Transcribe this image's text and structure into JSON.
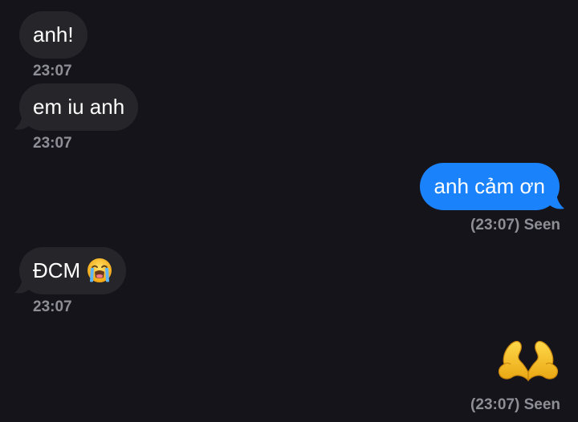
{
  "messages": [
    {
      "direction": "incoming",
      "text": "anh!",
      "time": "23:07"
    },
    {
      "direction": "incoming",
      "text": "em iu anh",
      "time": "23:07"
    },
    {
      "direction": "outgoing",
      "text": "anh cảm ơn",
      "status": "(23:07) Seen"
    },
    {
      "direction": "incoming",
      "text": "ĐCM",
      "emoji": "loudly-crying-face-icon",
      "time": "23:07"
    },
    {
      "direction": "outgoing",
      "emoji": "heart-hands-icon",
      "status": "(23:07) Seen"
    }
  ],
  "colors": {
    "background": "#16141b",
    "incoming_bubble": "#26262a",
    "outgoing_bubble": "#1a82fb",
    "meta_text": "#8e8e96"
  }
}
